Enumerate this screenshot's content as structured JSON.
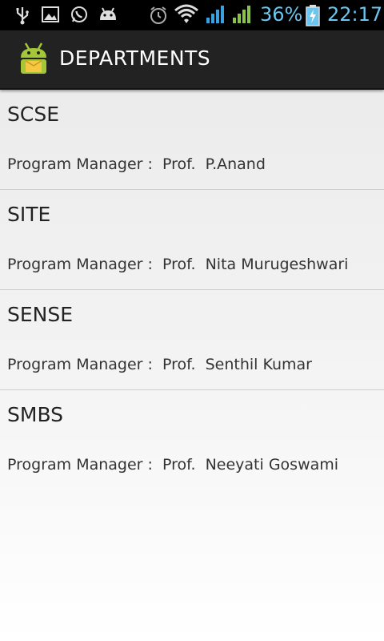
{
  "status_bar": {
    "battery_percent": "36%",
    "time": "22:17",
    "icons": [
      "usb-icon",
      "gallery-icon",
      "whatsapp-icon",
      "android-debug-icon",
      "alarm-icon",
      "wifi-icon",
      "signal-icon",
      "signal-icon",
      "battery-charging-icon"
    ]
  },
  "action_bar": {
    "title": "DEPARTMENTS",
    "icon": "android-app-icon"
  },
  "departments": [
    {
      "name": "SCSE",
      "manager": "Program Manager :  Prof.  P.Anand"
    },
    {
      "name": "SITE",
      "manager": "Program Manager :  Prof.  Nita Murugeshwari"
    },
    {
      "name": "SENSE",
      "manager": "Program Manager :  Prof.  Senthil Kumar"
    },
    {
      "name": "SMBS",
      "manager": "Program Manager :  Prof.  Neeyati Goswami"
    }
  ],
  "colors": {
    "status_text": "#6bc5f0",
    "signal_blue": "#3aa0e0",
    "signal_green": "#8bc34a",
    "action_bar": "#222222"
  }
}
